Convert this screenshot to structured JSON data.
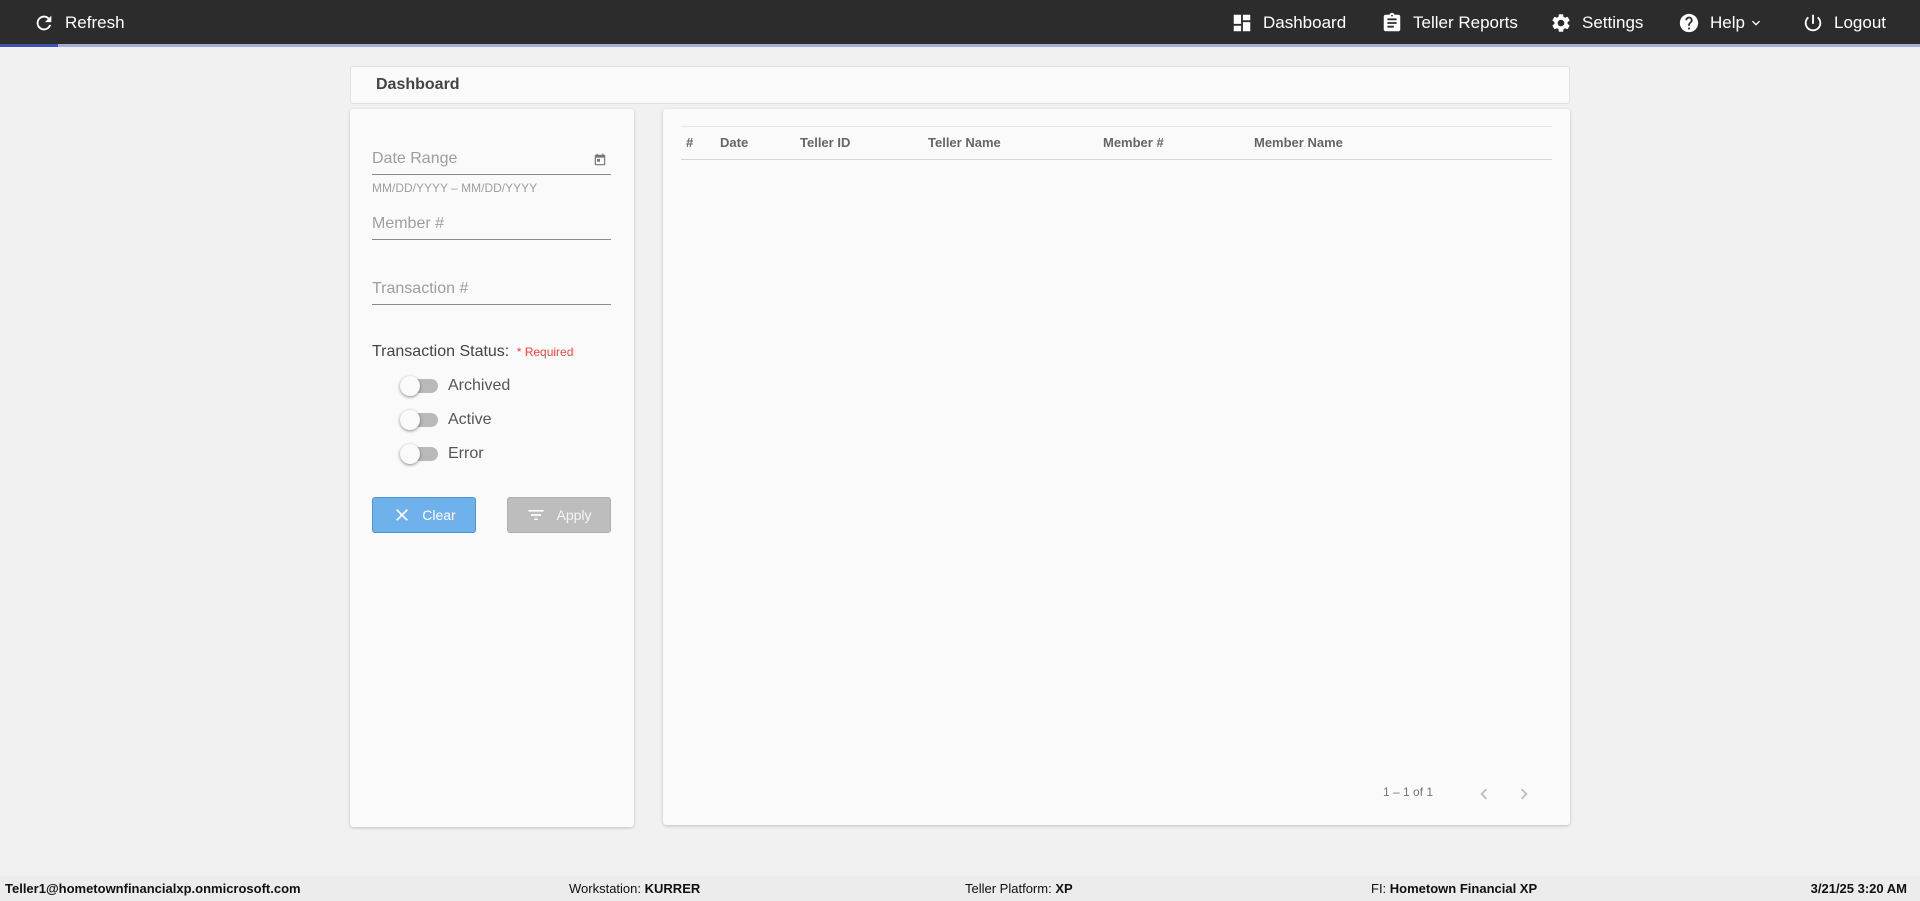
{
  "topbar": {
    "refresh_label": "Refresh",
    "dashboard_label": "Dashboard",
    "teller_reports_label": "Teller Reports",
    "settings_label": "Settings",
    "help_label": "Help",
    "logout_label": "Logout",
    "progress_fraction": 0.03
  },
  "page": {
    "title": "Dashboard"
  },
  "filters": {
    "date_range_placeholder": "Date Range",
    "date_range_hint": "MM/DD/YYYY – MM/DD/YYYY",
    "member_placeholder": "Member #",
    "transaction_placeholder": "Transaction #",
    "status_label": "Transaction Status:",
    "required_label": "* Required",
    "toggles": [
      {
        "label": "Archived",
        "on": false
      },
      {
        "label": "Active",
        "on": false
      },
      {
        "label": "Error",
        "on": false
      }
    ],
    "clear_label": "Clear",
    "apply_label": "Apply"
  },
  "table": {
    "columns": [
      "#",
      "Date",
      "Teller ID",
      "Teller Name",
      "Member #",
      "Member Name"
    ],
    "rows": []
  },
  "paginator": {
    "range_label": "1 – 1 of 1"
  },
  "footer": {
    "user": "Teller1@hometownfinancialxp.onmicrosoft.com",
    "workstation_label": "Workstation:",
    "workstation_value": "KURRER",
    "platform_label": "Teller Platform:",
    "platform_value": "XP",
    "fi_label": "FI:",
    "fi_value": "Hometown Financial XP",
    "datetime": "3/21/25 3:20 AM"
  }
}
